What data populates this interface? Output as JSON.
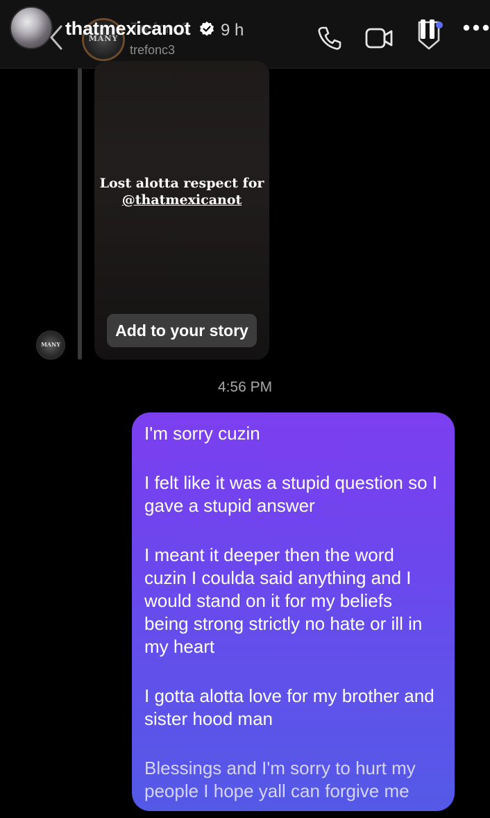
{
  "header": {
    "story_username": "thatmexicanot",
    "story_time": "9 h",
    "ghost_name": "Trefonc3",
    "chat_handle": "trefonc3",
    "chat_avatar_text": "MANY",
    "icons": [
      "back-arrow-icon",
      "verified-badge-icon",
      "phone-icon",
      "video-call-icon",
      "pause-icon",
      "flag-icon",
      "more-icon"
    ]
  },
  "shared_story": {
    "line1": "Lost alotta respect for",
    "mention": "@thatmexicanot",
    "button_label": "Add to your story",
    "sender_avatar_text": "MANY"
  },
  "timestamp": "4:56 PM",
  "message": {
    "paragraphs": [
      "I'm sorry cuzin",
      "I felt like it was a stupid question so I gave a stupid answer",
      "I meant it deeper then the word cuzin I coulda said anything and I would stand on it for my beliefs being strong strictly no hate or ill in my heart",
      "I gotta alotta love for my brother and sister hood man",
      "Blessings and I'm sorry to hurt my people I hope yall can forgive me"
    ]
  },
  "colors": {
    "background": "#000000",
    "bubble_top": "#7c3ff0",
    "bubble_bottom": "#5459e6",
    "button_bg": "#3c3c3c"
  }
}
